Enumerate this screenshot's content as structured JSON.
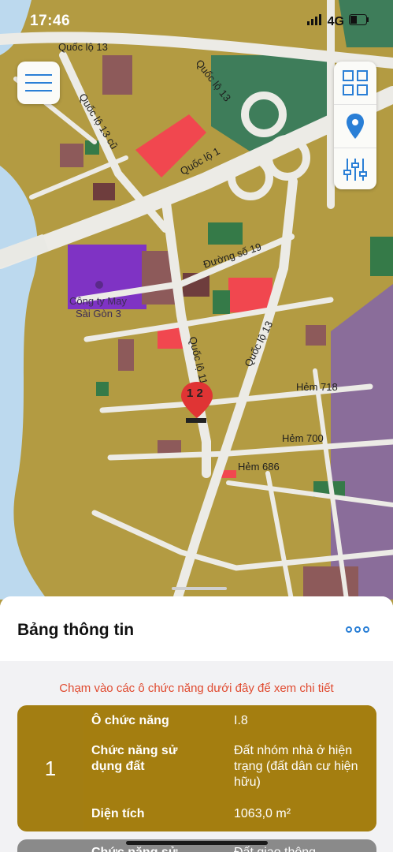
{
  "status_bar": {
    "time": "17:46",
    "network": "4G"
  },
  "map": {
    "roads": {
      "ql13_top": "Quốc lộ 13",
      "ql13_diag": "Quốc lộ 13",
      "ql13_cu": "Quốc lộ 13 cũ",
      "ql1": "Quốc lộ 1",
      "duong19": "Đường số 19",
      "ql13_mid": "Quốc lộ 13",
      "ql13_inner": "Quốc lộ 11",
      "hem718": "Hẻm 718",
      "hem700": "Hẻm 700",
      "hem686": "Hẻm 686"
    },
    "poi": {
      "line1": "Công ty May",
      "line2": "Sài Gòn 3"
    },
    "marker_label": "1 2"
  },
  "toolbar": {
    "menu_icon": "hamburger-menu-icon",
    "grid_icon": "grid-icon",
    "location_icon": "location-pin-icon",
    "filter_icon": "sliders-icon"
  },
  "info_panel": {
    "title": "Bảng thông tin",
    "hint": "Chạm vào các ô chức năng dưới đây để xem chi tiết",
    "card": {
      "index": "1",
      "rows": [
        {
          "label": "Ô chức năng",
          "value": "I.8"
        },
        {
          "label": "Chức năng sử dụng đất",
          "value": "Đất nhóm nhà ở hiện trạng (đất dân cư hiện hữu)"
        },
        {
          "label": "Diện tích",
          "value": "1063,0 m²"
        }
      ]
    },
    "next_card_peek": {
      "label": "Chức năng sử",
      "value": "Đất giao thông"
    }
  },
  "colors": {
    "land_residential": "#b39b42",
    "land_industrial": "#7f33c4",
    "land_commercial": "#f1474f",
    "land_mixed": "#8d5a5a",
    "green": "#357a48",
    "water": "#bcd9ee",
    "road": "#ecebe6",
    "card_bg": "#a37e12",
    "hint_red": "#e04a2f",
    "accent_blue": "#2a7fd6"
  }
}
